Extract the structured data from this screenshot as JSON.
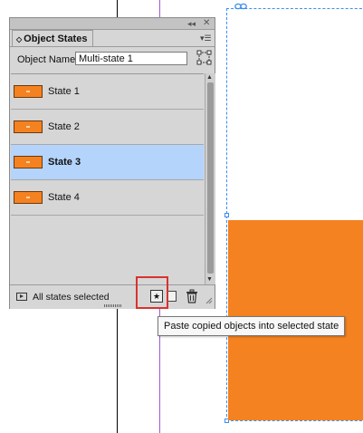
{
  "panel": {
    "tab_title": "Object States",
    "tab_arrow_glyph": "◇",
    "collapse_glyph": "◂◂",
    "close_glyph": "✕",
    "menu_glyph": "▾☰",
    "object_name_label": "Object Name:",
    "object_name_value": "Multi-state 1",
    "states": [
      {
        "label": "State 1",
        "selected": false
      },
      {
        "label": "State 2",
        "selected": false
      },
      {
        "label": "State 3",
        "selected": true
      },
      {
        "label": "State 4",
        "selected": false
      }
    ],
    "status_text": "All states selected",
    "paste_button_glyph": "★",
    "scroll_up_glyph": "▲",
    "scroll_down_glyph": "▼"
  },
  "tooltip": {
    "text": "Paste copied objects into selected state"
  },
  "colors": {
    "orange": "#f58220",
    "selection_row": "#b4d4fb",
    "frame_blue": "#3b8df0",
    "highlight_red": "#d9322f",
    "guide_purple": "#a25ad6"
  },
  "icons": {
    "collapse": "collapse-icon",
    "close": "close-icon",
    "panel_menu": "panel-menu-icon",
    "convert": "convert-to-mso-icon",
    "preview": "preview-icon",
    "paste_into_state": "paste-into-state-icon",
    "new_state": "new-state-icon",
    "delete": "trash-icon",
    "resize": "resize-grip-icon"
  }
}
